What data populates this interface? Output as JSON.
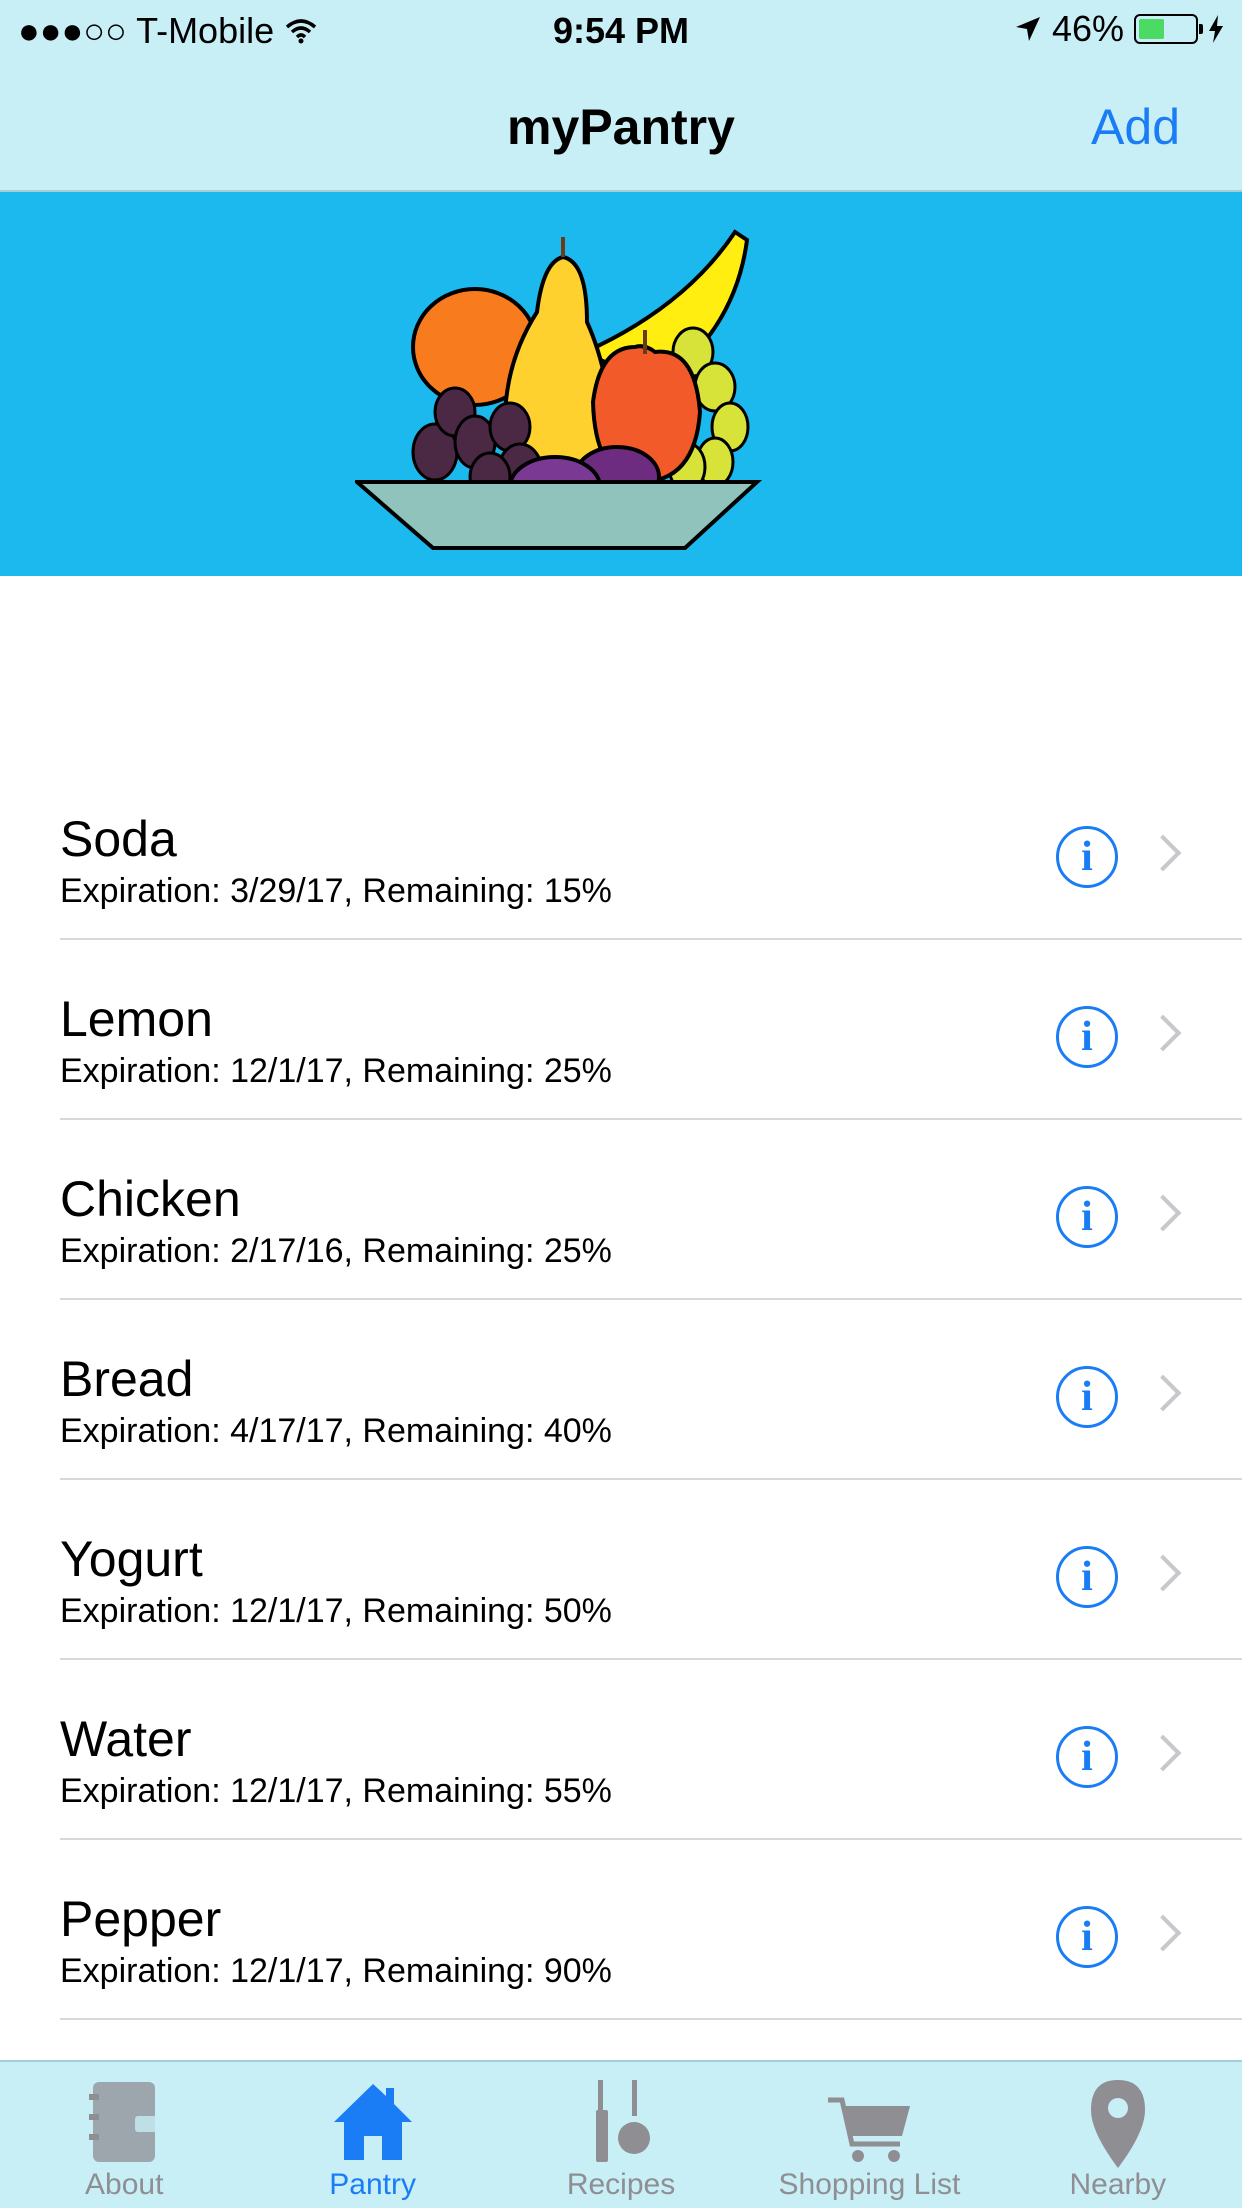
{
  "status_bar": {
    "carrier": "●●●○○ T-Mobile",
    "time": "9:54 PM",
    "battery": "46%",
    "battery_level": 0.46
  },
  "nav": {
    "title": "myPantry",
    "add_label": "Add"
  },
  "items": [
    {
      "name": "Soda",
      "detail": "Expiration: 3/29/17, Remaining: 15%"
    },
    {
      "name": "Lemon",
      "detail": "Expiration: 12/1/17, Remaining: 25%"
    },
    {
      "name": "Chicken",
      "detail": "Expiration: 2/17/16, Remaining: 25%"
    },
    {
      "name": "Bread",
      "detail": "Expiration: 4/17/17, Remaining: 40%"
    },
    {
      "name": "Yogurt",
      "detail": "Expiration: 12/1/17, Remaining: 50%"
    },
    {
      "name": "Water",
      "detail": "Expiration: 12/1/17, Remaining: 55%"
    },
    {
      "name": "Pepper",
      "detail": "Expiration: 12/1/17, Remaining: 90%"
    }
  ],
  "tabs": [
    {
      "label": "About",
      "icon": "notebook-icon"
    },
    {
      "label": "Pantry",
      "icon": "house-icon",
      "active": true
    },
    {
      "label": "Recipes",
      "icon": "utensils-icon"
    },
    {
      "label": "Shopping List",
      "icon": "cart-icon"
    },
    {
      "label": "Nearby",
      "icon": "map-pin-icon"
    }
  ],
  "colors": {
    "accent": "#1a7df5",
    "bar_background": "#c8eef6",
    "banner": "#1cb9ee",
    "battery_fill": "#4cd964"
  }
}
